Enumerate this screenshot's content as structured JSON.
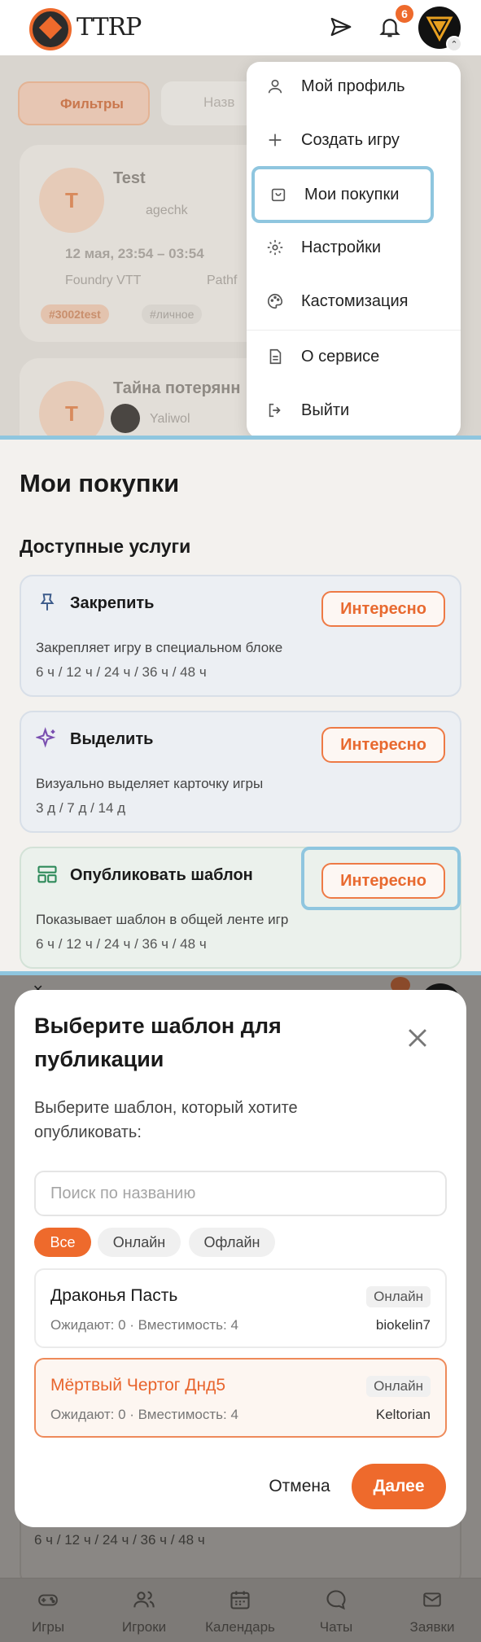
{
  "header": {
    "logo_text": "TTRP",
    "notifications_count": "6"
  },
  "menu": {
    "items": [
      {
        "label": "Мой профиль",
        "icon": "user-icon"
      },
      {
        "label": "Создать игру",
        "icon": "plus-icon"
      },
      {
        "label": "Мои покупки",
        "icon": "bag-icon",
        "active": true
      },
      {
        "label": "Настройки",
        "icon": "gear-icon"
      },
      {
        "label": "Кастомизация",
        "icon": "palette-icon"
      },
      {
        "label": "О сервисе",
        "icon": "document-icon"
      },
      {
        "label": "Выйти",
        "icon": "logout-icon"
      }
    ]
  },
  "background_feed": {
    "filters_label": "Фильтры",
    "search_placeholder": "Назв",
    "card1_title": "Test",
    "card1_author": "agechk",
    "card1_date": "12 мая, 23:54 – 03:54",
    "card1_platform": "Foundry VTT",
    "card1_place": "Pathf",
    "card1_tag1": "#3002test",
    "card1_tag2": "#личное",
    "card2_title": "Тайна потерянн",
    "card2_author": "Yaliwol",
    "circle_letter": "T"
  },
  "purchases": {
    "title": "Мои покупки",
    "section_title": "Доступные услуги",
    "services": [
      {
        "title": "Закрепить",
        "description": "Закрепляет игру в специальном блоке",
        "durations": "6 ч / 12 ч / 24 ч / 36 ч / 48 ч",
        "button": "Интересно",
        "icon": "pin-icon"
      },
      {
        "title": "Выделить",
        "description": "Визуально выделяет карточку игры",
        "durations": "3 д / 7 д / 14 д",
        "button": "Интересно",
        "icon": "sparkle-icon"
      },
      {
        "title": "Опубликовать шаблон",
        "description": "Показывает шаблон в общей ленте игр",
        "durations": "6 ч / 12 ч / 24 ч / 36 ч / 48 ч",
        "button": "Интересно",
        "icon": "layout-icon"
      }
    ]
  },
  "modal": {
    "title": "Выберите шаблон для публикации",
    "subtitle": "Выберите шаблон, который хотите опубликовать:",
    "search_placeholder": "Поиск по названию",
    "filters": [
      "Все",
      "Онлайн",
      "Офлайн"
    ],
    "templates": [
      {
        "name": "Драконья Пасть",
        "meta": "Ожидают: 0 · Вместимость: 4",
        "badge": "Онлайн",
        "owner": "biokelin7",
        "selected": false
      },
      {
        "name": "Мёртвый Чертог Днд5",
        "meta": "Ожидают: 0 · Вместимость: 4",
        "badge": "Онлайн",
        "owner": "Keltorian",
        "selected": true
      }
    ],
    "cancel_label": "Отмена",
    "next_label": "Далее"
  },
  "behind_modal": {
    "durations": "6 ч / 12 ч / 24 ч / 36 ч / 48 ч"
  },
  "tabbar": {
    "tabs": [
      {
        "label": "Игры",
        "icon": "gamepad-icon"
      },
      {
        "label": "Игроки",
        "icon": "users-icon"
      },
      {
        "label": "Календарь",
        "icon": "calendar-icon"
      },
      {
        "label": "Чаты",
        "icon": "chat-icon"
      },
      {
        "label": "Заявки",
        "icon": "mail-icon"
      }
    ]
  },
  "colors": {
    "accent": "#ee6a2c",
    "highlight": "#8fc6df"
  }
}
